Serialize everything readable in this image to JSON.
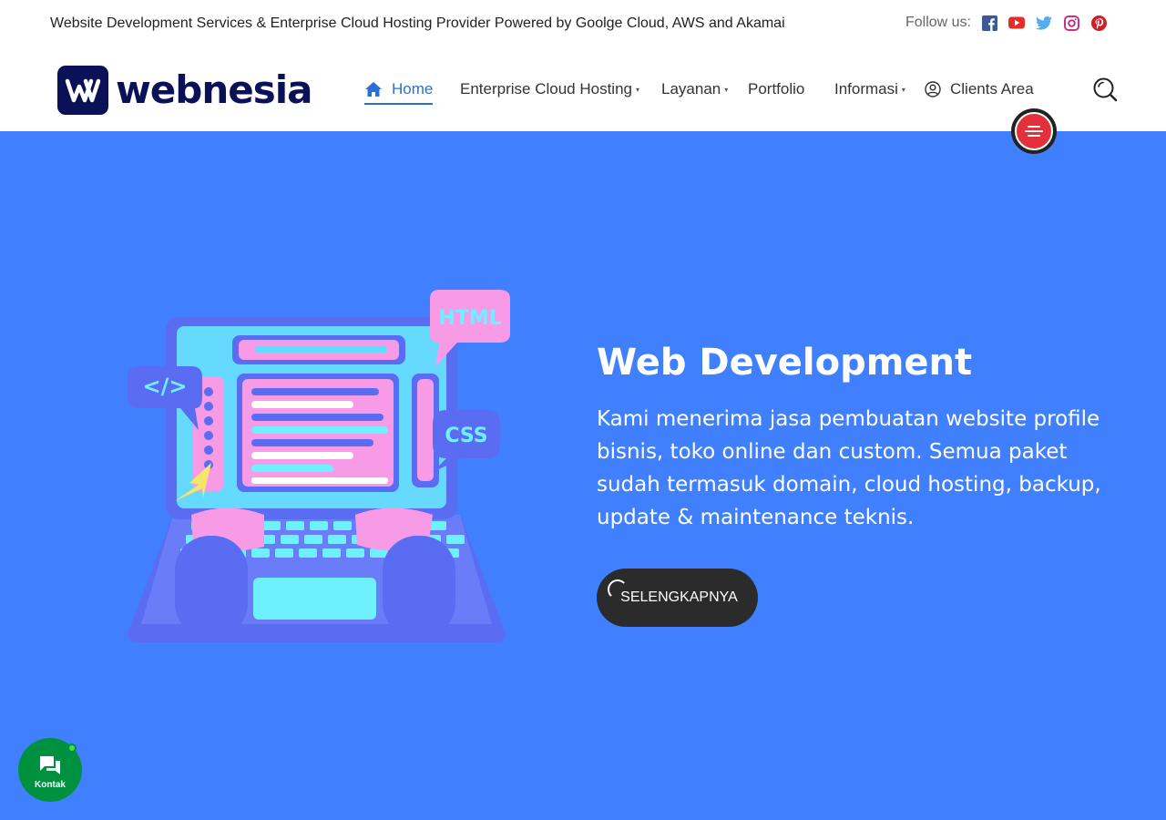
{
  "topbar": {
    "tagline": "Website Development Services & Enterprise Cloud Hosting Provider Powered by Goolge Cloud, AWS and Akamai",
    "follow_label": "Follow us:",
    "socials": [
      {
        "icon": "facebook-icon",
        "color": "#3b5998"
      },
      {
        "icon": "youtube-icon",
        "color": "#e52d27"
      },
      {
        "icon": "twitter-icon",
        "color": "#55acee"
      },
      {
        "icon": "instagram-icon",
        "color": "#c13584"
      },
      {
        "icon": "pinterest-icon",
        "color": "#cb2027"
      }
    ]
  },
  "brand": {
    "name": "webnesia",
    "color": "#0b1157"
  },
  "nav": {
    "items": [
      {
        "label": "Home",
        "active": true,
        "icon": "home-icon"
      },
      {
        "label": "Enterprise Cloud Hosting",
        "dropdown": true
      },
      {
        "label": "Layanan",
        "dropdown": true
      },
      {
        "label": "Portfolio"
      },
      {
        "label": "Informasi",
        "dropdown": true
      },
      {
        "label": "Clients Area",
        "icon": "user-circle-icon"
      }
    ],
    "accent": "#2a6fd3"
  },
  "hero": {
    "title": "Web Development",
    "description": "Kami menerima jasa pembuatan website profile bisnis, toko online dan custom. Semua paket sudah termasuk domain, cloud hosting, backup, update & maintenance teknis.",
    "cta_label": "SELENGKAPNYA",
    "background": "#4080ff",
    "illustration": {
      "html_badge": "HTML",
      "css_badge": "CSS",
      "code_badge": "</>"
    }
  },
  "chat": {
    "label": "Kontak",
    "color": "#009140"
  }
}
